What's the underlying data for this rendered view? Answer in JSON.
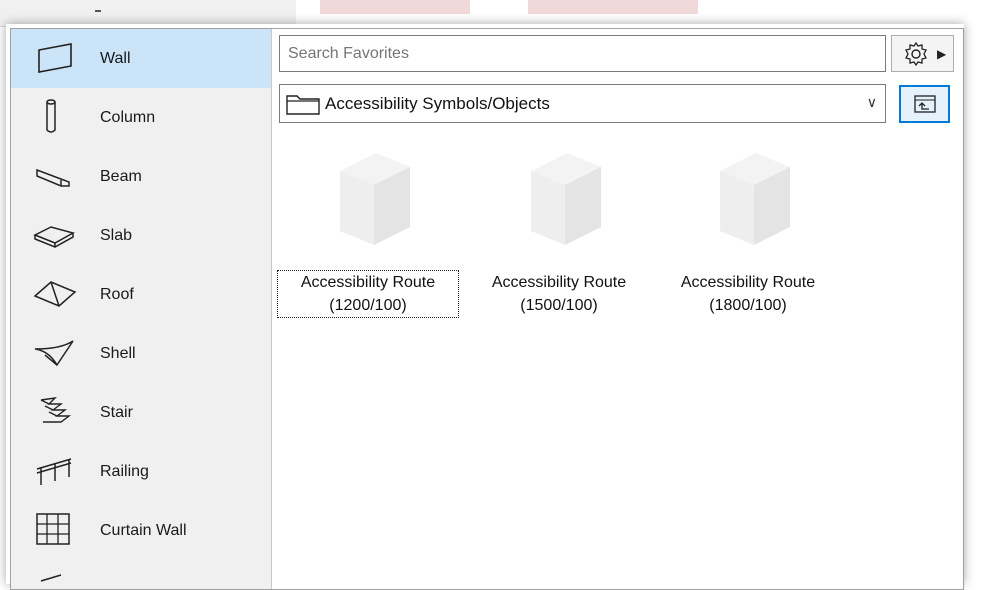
{
  "tool_list": {
    "items": [
      {
        "label": "Wall",
        "icon": "wall-icon",
        "selected": true
      },
      {
        "label": "Column",
        "icon": "column-icon",
        "selected": false
      },
      {
        "label": "Beam",
        "icon": "beam-icon",
        "selected": false
      },
      {
        "label": "Slab",
        "icon": "slab-icon",
        "selected": false
      },
      {
        "label": "Roof",
        "icon": "roof-icon",
        "selected": false
      },
      {
        "label": "Shell",
        "icon": "shell-icon",
        "selected": false
      },
      {
        "label": "Stair",
        "icon": "stair-icon",
        "selected": false
      },
      {
        "label": "Railing",
        "icon": "railing-icon",
        "selected": false
      },
      {
        "label": "Curtain Wall",
        "icon": "curtain-wall-icon",
        "selected": false
      }
    ]
  },
  "search": {
    "placeholder": "Search Favorites",
    "value": ""
  },
  "settings": {
    "icon": "gear-icon",
    "menu_icon": "triangle-right-icon"
  },
  "folder": {
    "current": "Accessibility Symbols/Objects",
    "icon": "folder-icon",
    "dropdown_icon": "chevron-down-icon"
  },
  "up_button": {
    "icon": "folder-up-icon"
  },
  "items": [
    {
      "line1": "Accessibility Route",
      "line2": "(1200/100)",
      "focused": true
    },
    {
      "line1": "Accessibility Route",
      "line2": "(1500/100)",
      "focused": false
    },
    {
      "line1": "Accessibility Route",
      "line2": "(1800/100)",
      "focused": false
    }
  ],
  "colors": {
    "selected_bg": "#cce4f7",
    "focus_border": "#0078d7",
    "list_bg": "#f0f0f0"
  }
}
